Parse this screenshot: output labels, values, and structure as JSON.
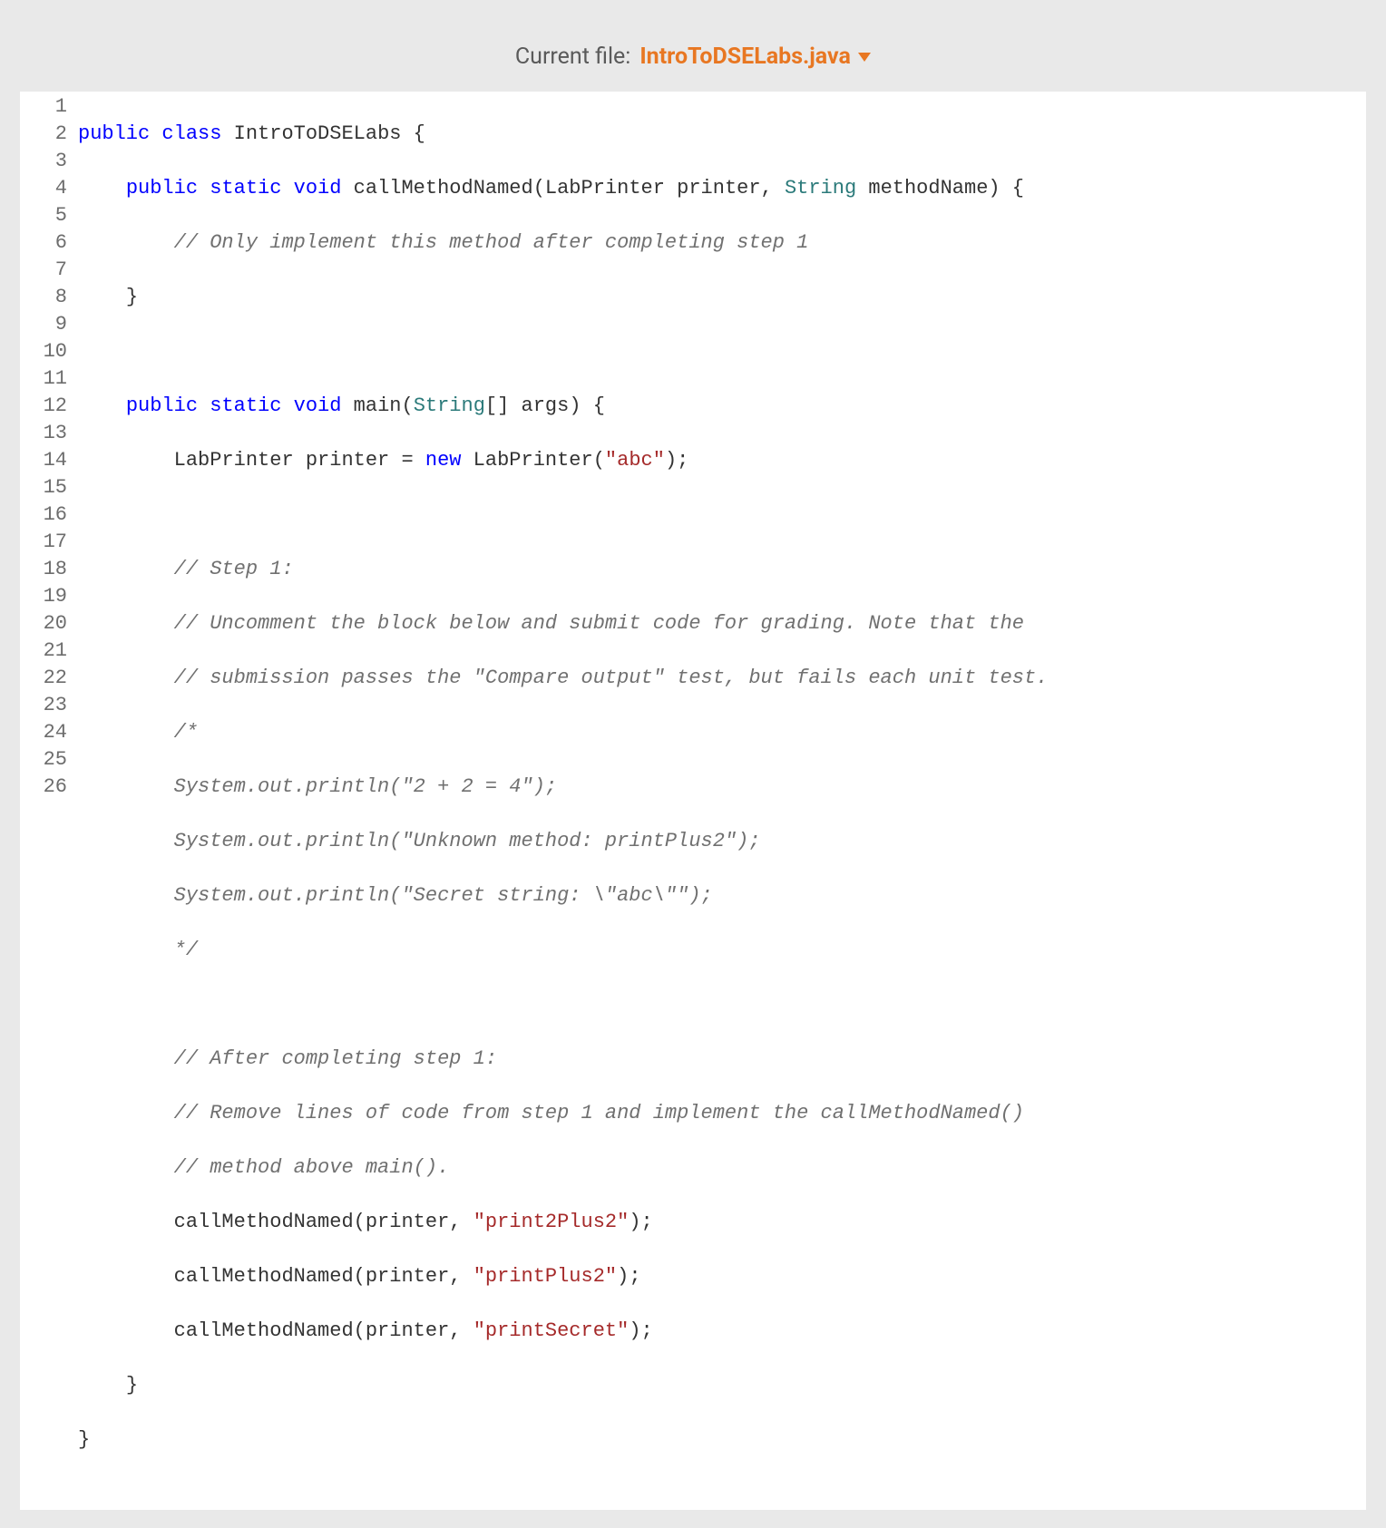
{
  "header": {
    "label": "Current file:",
    "filename": "IntroToDSELabs.java"
  },
  "lineNumbers": [
    "1",
    "2",
    "3",
    "4",
    "5",
    "6",
    "7",
    "8",
    "9",
    "10",
    "11",
    "12",
    "13",
    "14",
    "15",
    "16",
    "17",
    "18",
    "19",
    "20",
    "21",
    "22",
    "23",
    "24",
    "25",
    "26"
  ],
  "code": {
    "l1": {
      "kw1": "public",
      "kw2": "class",
      "cls": "IntroToDSELabs",
      "brace": " {"
    },
    "l2": {
      "indent": "    ",
      "kw1": "public",
      "kw2": "static",
      "kw3": "void",
      "name": "callMethodNamed(LabPrinter printer, ",
      "ty": "String",
      "rest": " methodName) {"
    },
    "l3": {
      "indent": "        ",
      "comment": "// Only implement this method after completing step 1"
    },
    "l4": {
      "indent": "    ",
      "brace": "}"
    },
    "l5": {
      "text": " "
    },
    "l6": {
      "indent": "    ",
      "kw1": "public",
      "kw2": "static",
      "kw3": "void",
      "name": " main(",
      "ty": "String",
      "rest": "[] args) {"
    },
    "l7": {
      "indent": "        ",
      "text1": "LabPrinter printer = ",
      "kw": "new",
      "text2": " LabPrinter(",
      "str": "\"abc\"",
      "text3": ");"
    },
    "l8": {
      "indent": "        ",
      "text": ""
    },
    "l9": {
      "indent": "        ",
      "comment": "// Step 1:"
    },
    "l10": {
      "indent": "        ",
      "comment": "// Uncomment the block below and submit code for grading. Note that the"
    },
    "l11": {
      "indent": "        ",
      "comment": "// submission passes the \"Compare output\" test, but fails each unit test."
    },
    "l12": {
      "indent": "        ",
      "comment": "/*"
    },
    "l13": {
      "indent": "        ",
      "comment": "System.out.println(\"2 + 2 = 4\");"
    },
    "l14": {
      "indent": "        ",
      "comment": "System.out.println(\"Unknown method: printPlus2\");"
    },
    "l15": {
      "indent": "        ",
      "comment": "System.out.println(\"Secret string: \\\"abc\\\"\");"
    },
    "l16": {
      "indent": "        ",
      "comment": "*/"
    },
    "l17": {
      "indent": "        ",
      "text": ""
    },
    "l18": {
      "indent": "        ",
      "comment": "// After completing step 1:"
    },
    "l19": {
      "indent": "        ",
      "comment": "// Remove lines of code from step 1 and implement the callMethodNamed()"
    },
    "l20": {
      "indent": "        ",
      "comment": "// method above main()."
    },
    "l21": {
      "indent": "        ",
      "text1": "callMethodNamed(printer, ",
      "str": "\"print2Plus2\"",
      "text2": ");"
    },
    "l22": {
      "indent": "        ",
      "text1": "callMethodNamed(printer, ",
      "str": "\"printPlus2\"",
      "text2": ");"
    },
    "l23": {
      "indent": "        ",
      "text1": "callMethodNamed(printer, ",
      "str": "\"printSecret\"",
      "text2": ");"
    },
    "l24": {
      "indent": "    ",
      "brace": "}"
    },
    "l25": {
      "text": "}"
    },
    "l26": {
      "text": ""
    }
  }
}
